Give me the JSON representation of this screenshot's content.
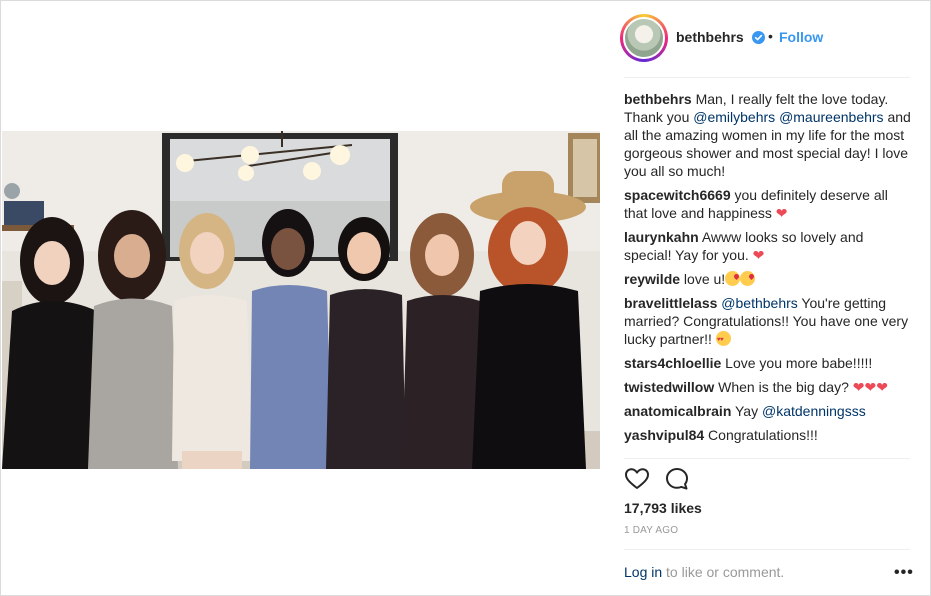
{
  "post": {
    "username": "bethbehrs",
    "follow_label": "Follow",
    "separator": "•",
    "verified_icon": "verified-badge-icon",
    "likes": "17,793 likes",
    "time": "1 DAY AGO",
    "login_link": "Log in",
    "login_rest": " to like or comment.",
    "more_label": "•••"
  },
  "caption": {
    "user": "bethbehrs",
    "text_1": " Man, I really felt the love today. Thank you ",
    "mention_1": "@emilybehrs",
    "text_2": " ",
    "mention_2": "@maureenbehrs",
    "text_3": " and all the amazing women in my life for the most gorgeous shower and most special day! I love you all so much!"
  },
  "comments": [
    {
      "user": "spacewitch6669",
      "text": " you definitely deserve all that love and happiness "
    },
    {
      "user": "laurynkahn",
      "text": " Awww looks so lovely and special! Yay for you. "
    },
    {
      "user": "reywilde",
      "text": " love u!"
    },
    {
      "user": "bravelittlelass",
      "mention": "@bethbehrs",
      "text": " You're getting married? Congratulations!! You have one very lucky partner!! "
    },
    {
      "user": "stars4chloellie",
      "text": " Love you more babe!!!!!"
    },
    {
      "user": "twistedwillow",
      "text": " When is the big day? "
    },
    {
      "user": "anatomicalbrain",
      "text": " Yay ",
      "mention": "@katdenningsss"
    },
    {
      "user": "yashvipul84",
      "text": " Congratulations!!!"
    }
  ],
  "colors": {
    "link": "#003569",
    "follow": "#3897f0",
    "heart": "#ed4956",
    "muted": "#999999"
  }
}
